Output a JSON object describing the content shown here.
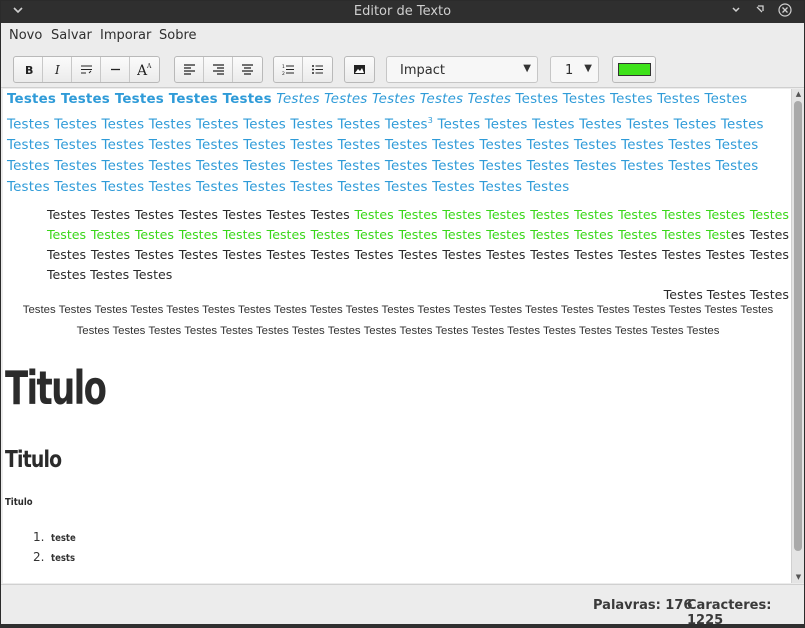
{
  "window": {
    "title": "Editor de Texto",
    "menu_icon": "chevron-down-icon",
    "minimize_icon": "minimize-icon",
    "maximize_icon": "maximize-icon",
    "close_icon": "close-icon"
  },
  "menu": {
    "items": [
      {
        "label": "Novo"
      },
      {
        "label": "Salvar"
      },
      {
        "label": "Imporar"
      },
      {
        "label": "Sobre"
      }
    ]
  },
  "toolbar": {
    "font": "Impact",
    "font_size": "1",
    "color": "#3ee21a"
  },
  "document": {
    "p1_bold": "Testes Testes Testes Testes Testes",
    "p1_italic": "Testes Testes Testes Testes Testes",
    "p1_a": "Testes Testes Testes Testes Testes Testes Testes Testes Testes Testes Testes Testes Testes Testes",
    "p1_sup": "3",
    "p1_b": "Testes Testes Testes Testes Testes Testes Testes Testes Testes Testes Testes Testes Testes Testes Testes Testes Testes Testes Testes Testes Testes Testes Testes Testes Testes Testes Testes Testes Testes Testes Testes Testes Testes Testes Testes Testes Testes Testes Testes Testes Testes Testes Testes Testes Testes Testes Testes Testes Testes Testes Testes",
    "p2_a": "Testes Testes Testes Testes Testes Testes Testes",
    "p2_green": "Testes Testes Testes Testes Testes Testes Testes Testes Testes Testes Testes Testes Testes Testes Testes Testes Testes Testes Testes Testes Testes Testes Testes Testes Testes Test",
    "p2_b": "es Testes Testes Testes Testes Testes Testes Testes Testes Testes Testes Testes Testes Testes Testes Testes Testes Testes Testes Testes Testes Testes",
    "p2_last": "Testes Testes Testes",
    "p3": "Testes Testes Testes Testes Testes Testes Testes Testes Testes Testes Testes Testes Testes Testes Testes Testes Testes Testes Testes Testes Testes Testes Testes Testes Testes Testes Testes Testes Testes Testes Testes Testes Testes Testes Testes Testes Testes Testes Testes",
    "h1": "Titulo",
    "h2": "Titulo",
    "h3": "Titulo",
    "list": [
      {
        "num": "1.",
        "text": "teste"
      },
      {
        "num": "2.",
        "text": "tests"
      }
    ]
  },
  "status": {
    "words": "Palavras: 176",
    "chars": "Caracteres: 1225"
  }
}
